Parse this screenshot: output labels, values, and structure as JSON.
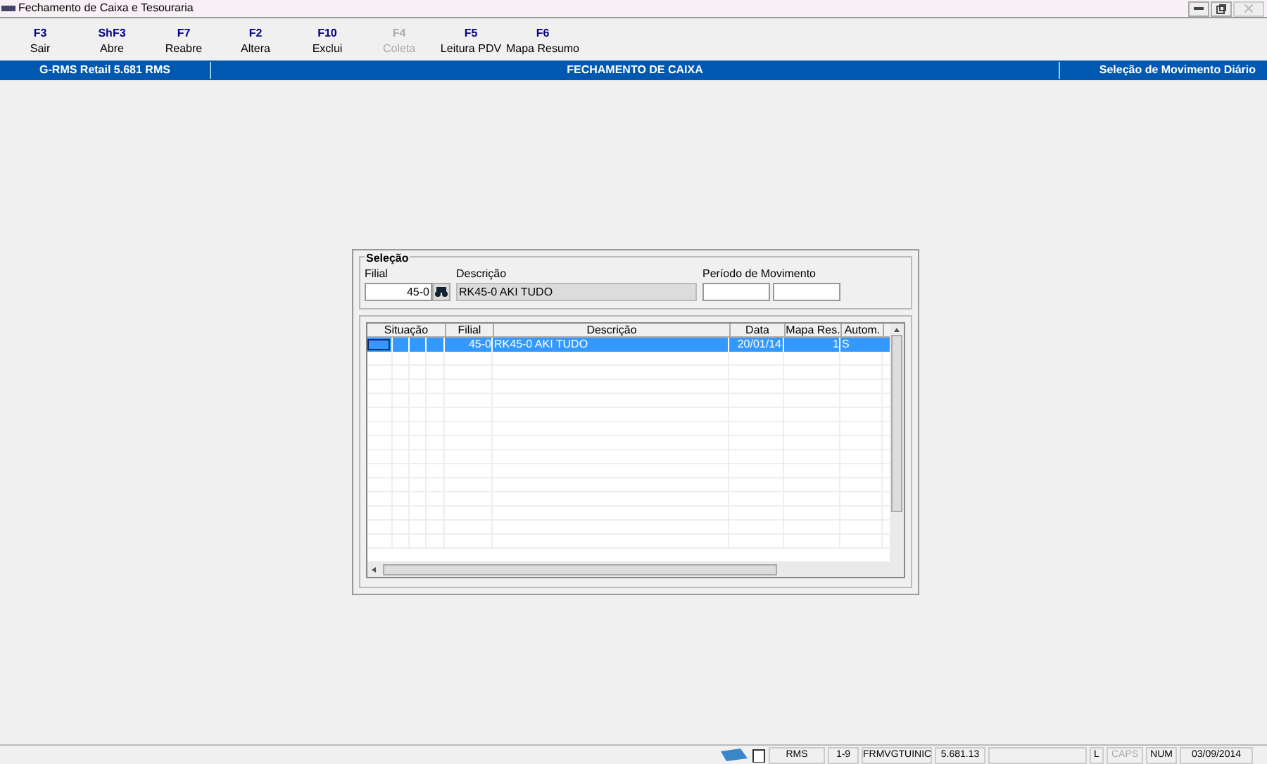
{
  "window": {
    "title": "Fechamento de Caixa e Tesouraria"
  },
  "toolbar": [
    {
      "key": "F3",
      "label": "Sair",
      "disabled": false
    },
    {
      "key": "ShF3",
      "label": "Abre",
      "disabled": false
    },
    {
      "key": "F7",
      "label": "Reabre",
      "disabled": false
    },
    {
      "key": "F2",
      "label": "Altera",
      "disabled": false
    },
    {
      "key": "F10",
      "label": "Exclui",
      "disabled": false
    },
    {
      "key": "F4",
      "label": "Coleta",
      "disabled": true
    },
    {
      "key": "F5",
      "label": "Leitura PDV",
      "disabled": false
    },
    {
      "key": "F6",
      "label": "Mapa Resumo",
      "disabled": false
    }
  ],
  "header": {
    "left": "G-RMS Retail 5.681 RMS",
    "center": "FECHAMENTO DE CAIXA",
    "right": "Seleção de Movimento Diário"
  },
  "selection": {
    "legend": "Seleção",
    "filial_label": "Filial",
    "filial_value": "45-0",
    "descricao_label": "Descrição",
    "descricao_value": "RK45-0 AKI TUDO",
    "periodo_label": "Período de Movimento"
  },
  "table": {
    "columns": [
      "Situação",
      "Filial",
      "Descrição",
      "Data",
      "Mapa Res.",
      "Autom."
    ],
    "rows": [
      {
        "filial": "45-0",
        "descricao": "RK45-0 AKI TUDO",
        "data": "20/01/14",
        "mapa": "1",
        "autom": "S",
        "selected": true
      }
    ]
  },
  "status_bar": [
    {
      "text": "RMS",
      "disabled": false
    },
    {
      "text": "1-9",
      "disabled": false
    },
    {
      "text": "FRMVGTUINIC",
      "disabled": false
    },
    {
      "text": "5.681.13",
      "disabled": false
    },
    {
      "text": "L",
      "disabled": false
    },
    {
      "text": "CAPS",
      "disabled": true
    },
    {
      "text": "NUM",
      "disabled": false
    },
    {
      "text": "03/09/2014",
      "disabled": false
    }
  ]
}
